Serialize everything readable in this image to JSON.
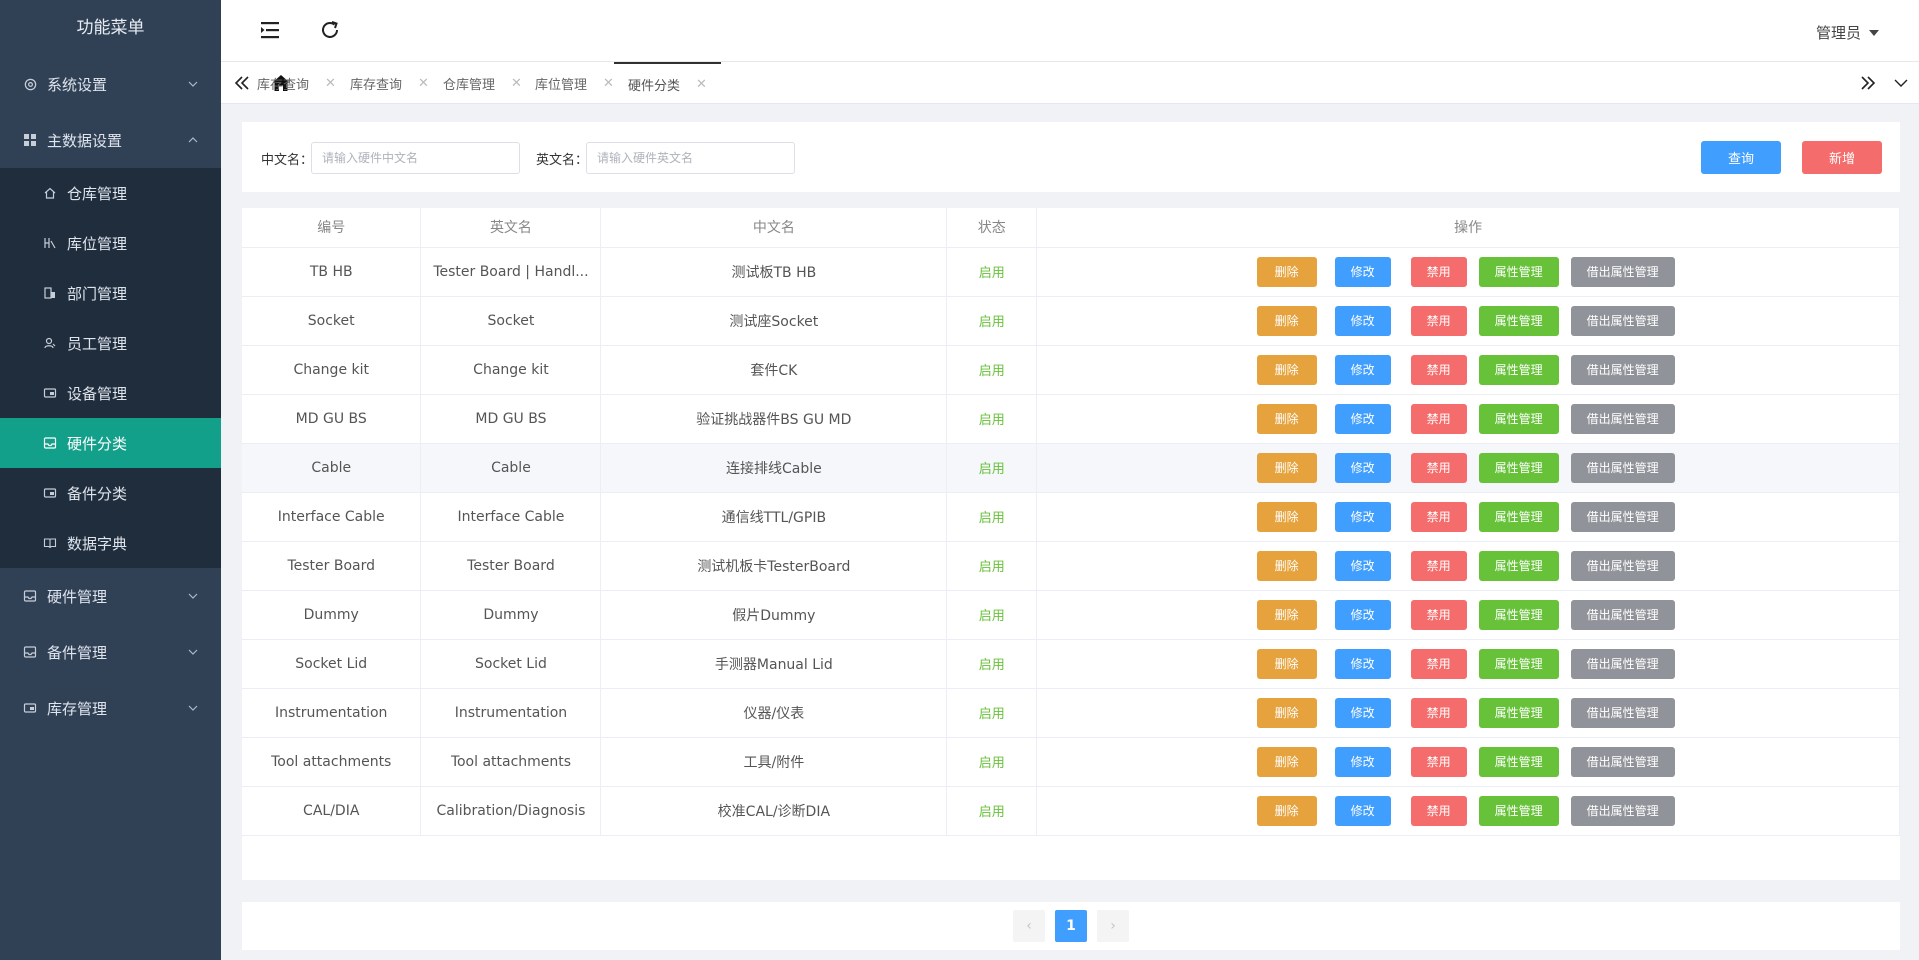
{
  "sidebar": {
    "title": "功能菜单",
    "groups": [
      {
        "label": "系统设置"
      },
      {
        "label": "主数据设置"
      },
      {
        "label": "硬件管理"
      },
      {
        "label": "备件管理"
      },
      {
        "label": "库存管理"
      }
    ],
    "subitems": [
      {
        "label": "仓库管理"
      },
      {
        "label": "库位管理"
      },
      {
        "label": "部门管理"
      },
      {
        "label": "员工管理"
      },
      {
        "label": "设备管理"
      },
      {
        "label": "硬件分类"
      },
      {
        "label": "备件分类"
      },
      {
        "label": "数据字典"
      }
    ]
  },
  "header": {
    "user": "管理员"
  },
  "tabs": [
    {
      "label": "库存查询"
    },
    {
      "label": "库存查询"
    },
    {
      "label": "仓库管理"
    },
    {
      "label": "库位管理"
    },
    {
      "label": "硬件分类"
    }
  ],
  "search": {
    "cn_label": "中文名：",
    "cn_placeholder": "请输入硬件中文名",
    "en_label": "英文名：",
    "en_placeholder": "请输入硬件英文名",
    "query_label": "查询",
    "add_label": "新增"
  },
  "table": {
    "columns": [
      "编号",
      "英文名",
      "中文名",
      "状态",
      "操作"
    ],
    "actions": {
      "delete": "删除",
      "edit": "修改",
      "disable": "禁用",
      "attr": "属性管理",
      "borrow": "借出属性管理"
    },
    "rows": [
      {
        "code": "TB HB",
        "en": "Tester Board | Handl...",
        "cn": "测试板TB HB",
        "status": "启用"
      },
      {
        "code": "Socket",
        "en": "Socket",
        "cn": "测试座Socket",
        "status": "启用"
      },
      {
        "code": "Change kit",
        "en": "Change kit",
        "cn": "套件CK",
        "status": "启用"
      },
      {
        "code": "MD GU BS",
        "en": "MD GU BS",
        "cn": "验证挑战器件BS GU MD",
        "status": "启用"
      },
      {
        "code": "Cable",
        "en": "Cable",
        "cn": "连接排线Cable",
        "status": "启用"
      },
      {
        "code": "Interface Cable",
        "en": "Interface Cable",
        "cn": "通信线TTL/GPIB",
        "status": "启用"
      },
      {
        "code": "Tester Board",
        "en": "Tester Board",
        "cn": "测试机板卡TesterBoard",
        "status": "启用"
      },
      {
        "code": "Dummy",
        "en": "Dummy",
        "cn": "假片Dummy",
        "status": "启用"
      },
      {
        "code": "Socket Lid",
        "en": "Socket Lid",
        "cn": "手测器Manual Lid",
        "status": "启用"
      },
      {
        "code": "Instrumentation",
        "en": "Instrumentation",
        "cn": "仪器/仪表",
        "status": "启用"
      },
      {
        "code": "Tool attachments",
        "en": "Tool attachments",
        "cn": "工具/附件",
        "status": "启用"
      },
      {
        "code": "CAL/DIA",
        "en": "Calibration/Diagnosis",
        "cn": "校准CAL/诊断DIA",
        "status": "启用"
      }
    ]
  },
  "pagination": {
    "current": "1",
    "prev": "‹",
    "next": "›"
  }
}
